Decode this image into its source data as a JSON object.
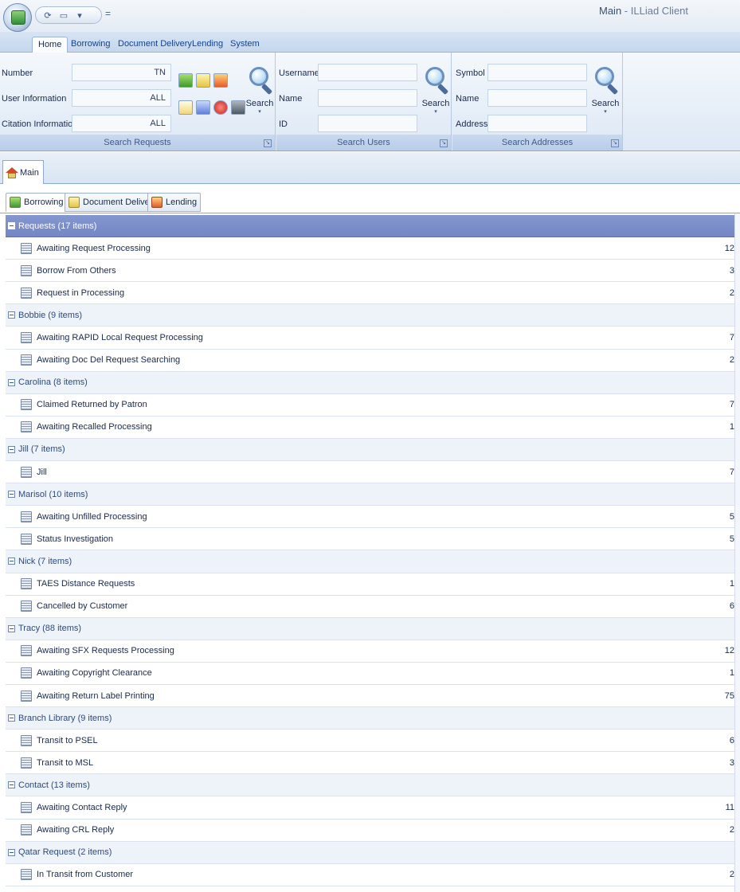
{
  "window": {
    "title_main": "Main",
    "title_sep": " - ",
    "title_app": "ILLiad Client"
  },
  "quick_access": {
    "separator": "="
  },
  "ribbon_tabs": [
    {
      "label": "Home"
    },
    {
      "label": "Borrowing"
    },
    {
      "label": "Document Delivery"
    },
    {
      "label": "Lending"
    },
    {
      "label": "System"
    }
  ],
  "search_requests": {
    "caption": "Search Requests",
    "fields": [
      {
        "label": "Number",
        "value": "TN"
      },
      {
        "label": "User Information",
        "value": "ALL"
      },
      {
        "label": "Citation Information",
        "value": "ALL"
      }
    ],
    "search_label": "Search",
    "search_arrow": "▾"
  },
  "search_users": {
    "caption": "Search Users",
    "fields": [
      {
        "label": "Username",
        "value": ""
      },
      {
        "label": "Name",
        "value": ""
      },
      {
        "label": "ID",
        "value": ""
      }
    ],
    "search_label": "Search",
    "search_arrow": "▾"
  },
  "search_addresses": {
    "caption": "Search Addresses",
    "fields": [
      {
        "label": "Symbol",
        "value": ""
      },
      {
        "label": "Name",
        "value": ""
      },
      {
        "label": "Address",
        "value": ""
      }
    ],
    "search_label": "Search",
    "search_arrow": "▾"
  },
  "launcher_glyph": "↘",
  "document_tab": {
    "label": "Main"
  },
  "subtabs": [
    {
      "label": "Borrowing"
    },
    {
      "label": "Document Delivery"
    },
    {
      "label": "Lending"
    }
  ],
  "queue_groups": [
    {
      "label": "Requests  (17 items)",
      "items": [
        {
          "label": "Awaiting Request Processing",
          "count": "12"
        },
        {
          "label": "Borrow From Others",
          "count": "3"
        },
        {
          "label": "Request in Processing",
          "count": "2"
        }
      ]
    },
    {
      "label": "Bobbie  (9 items)",
      "items": [
        {
          "label": "Awaiting RAPID Local Request Processing",
          "count": "7"
        },
        {
          "label": "Awaiting Doc Del Request Searching",
          "count": "2"
        }
      ]
    },
    {
      "label": "Carolina  (8 items)",
      "items": [
        {
          "label": "Claimed Returned by Patron",
          "count": "7"
        },
        {
          "label": "Awaiting Recalled Processing",
          "count": "1"
        }
      ]
    },
    {
      "label": "Jill  (7 items)",
      "items": [
        {
          "label": "Jill",
          "count": "7"
        }
      ]
    },
    {
      "label": "Marisol  (10 items)",
      "items": [
        {
          "label": "Awaiting Unfilled Processing",
          "count": "5"
        },
        {
          "label": "Status Investigation",
          "count": "5"
        }
      ]
    },
    {
      "label": "Nick  (7 items)",
      "items": [
        {
          "label": "TAES Distance Requests",
          "count": "1"
        },
        {
          "label": "Cancelled by Customer",
          "count": "6"
        }
      ]
    },
    {
      "label": "Tracy  (88 items)",
      "items": [
        {
          "label": "Awaiting SFX Requests Processing",
          "count": "12"
        },
        {
          "label": "Awaiting Copyright Clearance",
          "count": "1"
        },
        {
          "label": "Awaiting Return Label Printing",
          "count": "75"
        }
      ]
    },
    {
      "label": "Branch Library  (9 items)",
      "items": [
        {
          "label": "Transit to PSEL",
          "count": "6"
        },
        {
          "label": "Transit to MSL",
          "count": "3"
        }
      ]
    },
    {
      "label": "Contact  (13 items)",
      "items": [
        {
          "label": "Awaiting Contact Reply",
          "count": "11"
        },
        {
          "label": "Awaiting CRL Reply",
          "count": "2"
        }
      ]
    },
    {
      "label": "Qatar Request  (2 items)",
      "items": [
        {
          "label": "In Transit from Customer",
          "count": "2"
        }
      ]
    }
  ]
}
